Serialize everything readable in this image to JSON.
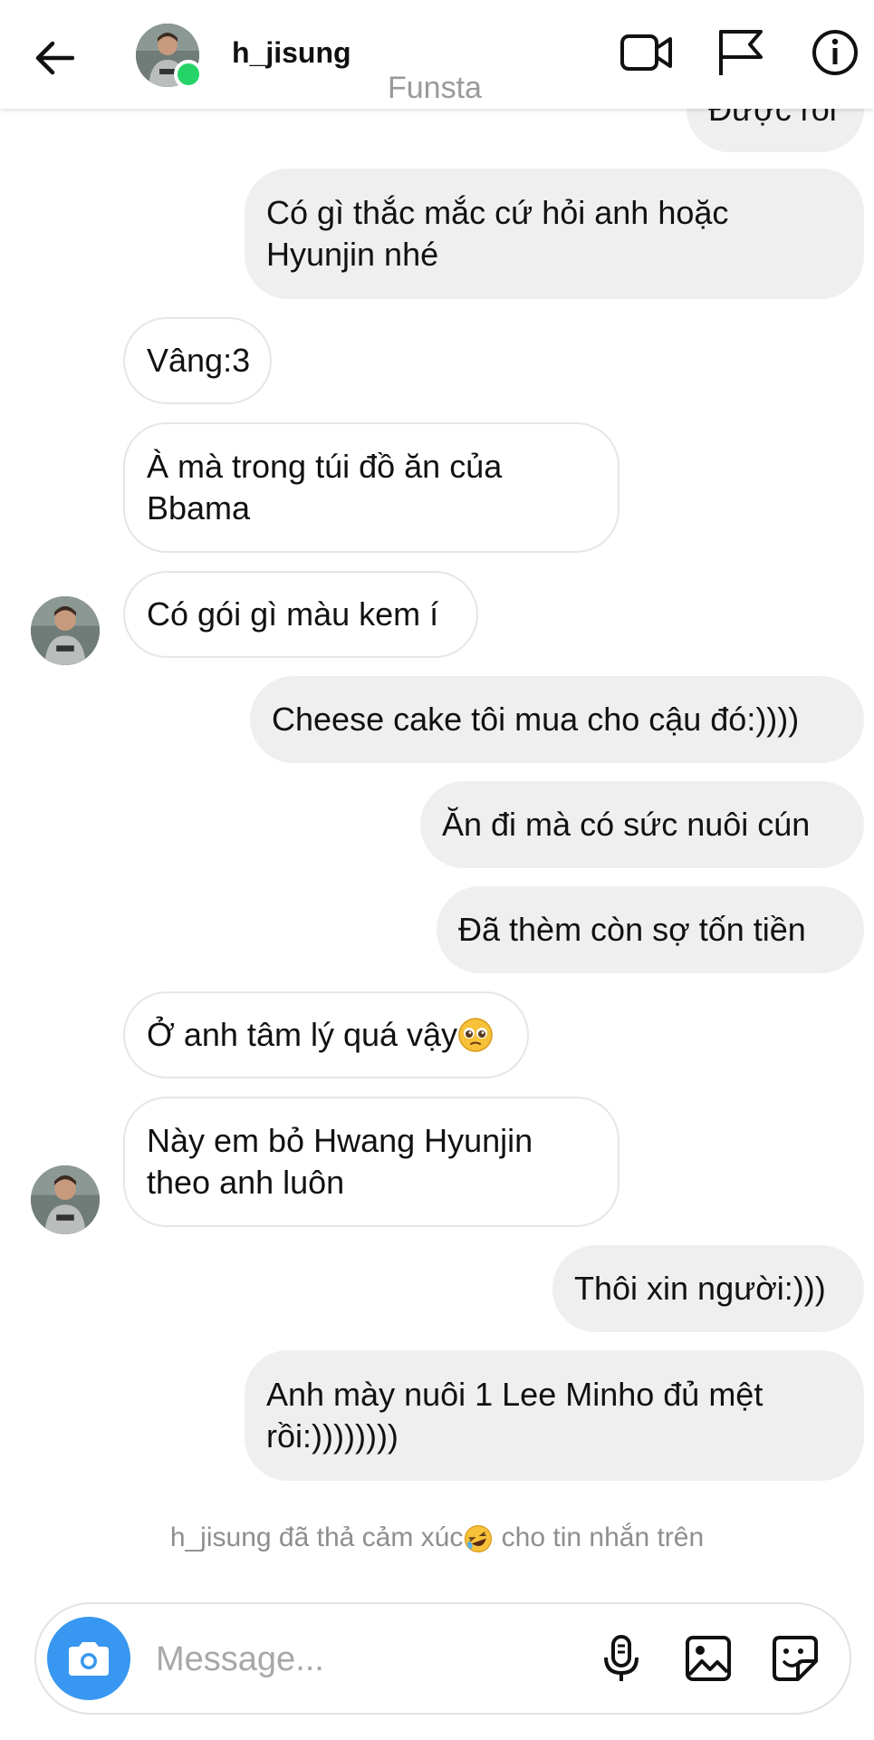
{
  "header": {
    "username": "h_jisung",
    "subtitle": "Funsta",
    "icons": [
      "back-arrow-icon",
      "video-call-icon",
      "flag-icon",
      "info-icon"
    ]
  },
  "messages": [
    {
      "id": "m0",
      "side": "out",
      "text": "Được rồi"
    },
    {
      "id": "m1",
      "side": "out",
      "text": "Có gì thắc mắc cứ hỏi anh hoặc\nHyunjin nhé"
    },
    {
      "id": "m2",
      "side": "in",
      "text": "Vâng:3"
    },
    {
      "id": "m3",
      "side": "in",
      "text": "À mà trong túi đồ ăn của\nBbama"
    },
    {
      "id": "m4",
      "side": "in",
      "text": "Có gói gì màu kem í"
    },
    {
      "id": "m5",
      "side": "out",
      "text": "Cheese cake tôi mua cho cậu đó:))))"
    },
    {
      "id": "m6",
      "side": "out",
      "text": "Ăn đi mà có sức nuôi cún"
    },
    {
      "id": "m7",
      "side": "out",
      "text": "Đã thèm còn sợ tốn tiền"
    },
    {
      "id": "m8",
      "side": "in",
      "text": "Ở anh tâm lý quá vậy"
    },
    {
      "id": "m9",
      "side": "in",
      "text": "Này em bỏ Hwang Hyunjin\ntheo anh luôn"
    },
    {
      "id": "m10",
      "side": "out",
      "text": "Thôi xin người:)))"
    },
    {
      "id": "m11",
      "side": "out",
      "text": "Anh mày nuôi 1 Lee Minho đủ mệt\nrồi:))))))))"
    }
  ],
  "reaction_note": {
    "before": "h_jisung đã thả cảm xúc",
    "after": " cho tin nhắn trên",
    "emoji": "rolling-laughing-emoji"
  },
  "composer": {
    "placeholder": "Message...",
    "icons": [
      "camera-icon",
      "microphone-icon",
      "gallery-icon",
      "sticker-icon"
    ]
  },
  "colors": {
    "camera_button": "#3897f0",
    "online_dot": "#25d366",
    "outgoing_bubble": "#efefef",
    "subtitle_text": "#9a9a9a"
  }
}
